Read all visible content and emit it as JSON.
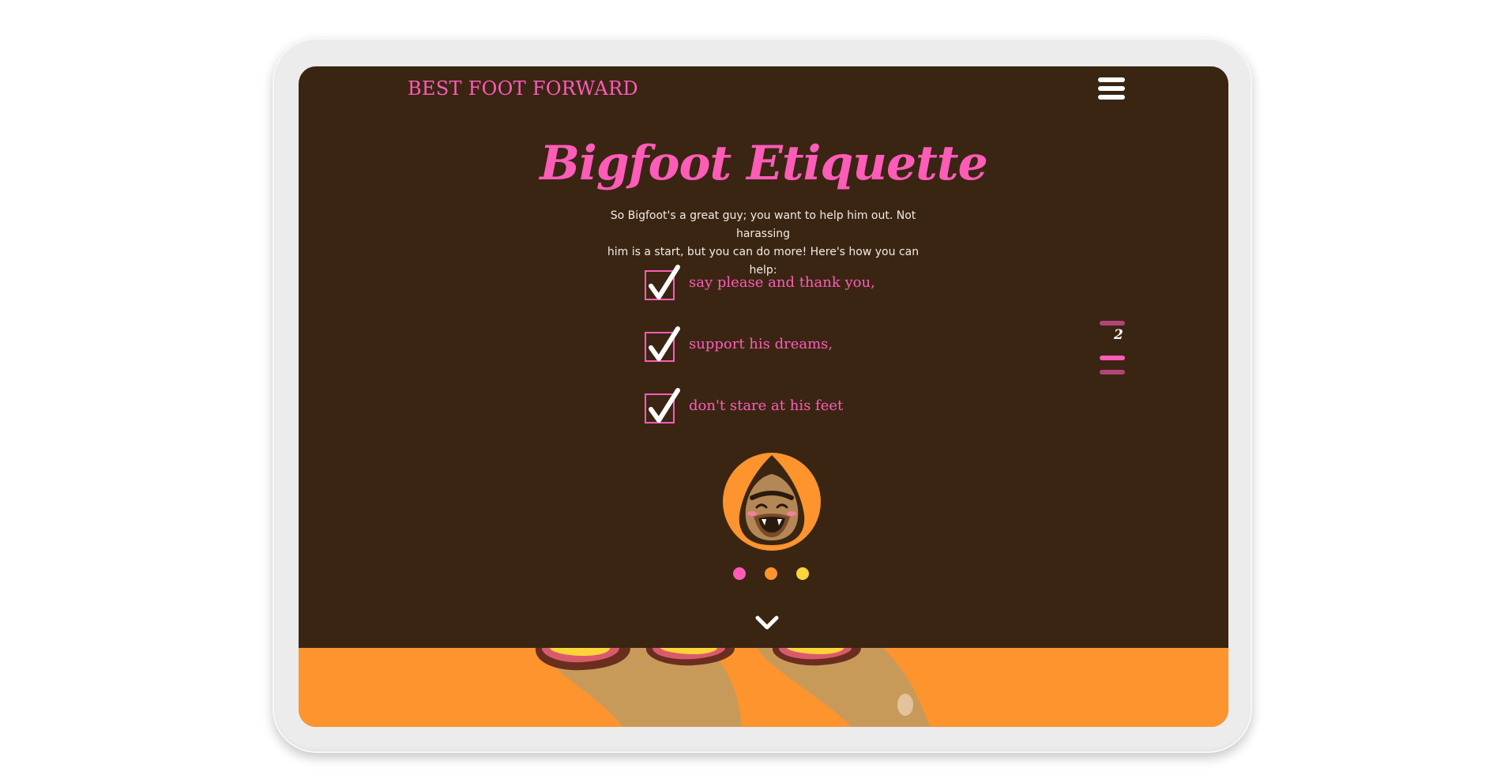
{
  "header": {
    "brand": "BEST FOOT FORWARD",
    "menu_icon": "hamburger-menu-icon"
  },
  "main": {
    "title": "Bigfoot Etiquette",
    "intro_line1": "So Bigfoot's a great guy; you want to help him out. Not harassing",
    "intro_line2": "him is a start, but you can do more! Here's how you can help:",
    "checklist": [
      {
        "label": "say please and thank you,",
        "checked": true
      },
      {
        "label": "support his dreams,",
        "checked": true
      },
      {
        "label": "don't stare at his feet",
        "checked": true
      }
    ]
  },
  "section_nav": {
    "current": "2"
  },
  "pager": {
    "dots": [
      {
        "color": "#ff5cb8"
      },
      {
        "color": "#fd942e"
      },
      {
        "color": "#ffd33a"
      }
    ]
  },
  "colors": {
    "background": "#3a2513",
    "accent_pink": "#ff5cb8",
    "accent_orange": "#fd942e",
    "accent_yellow": "#ffd33a",
    "text_light": "#f3ebe3"
  }
}
